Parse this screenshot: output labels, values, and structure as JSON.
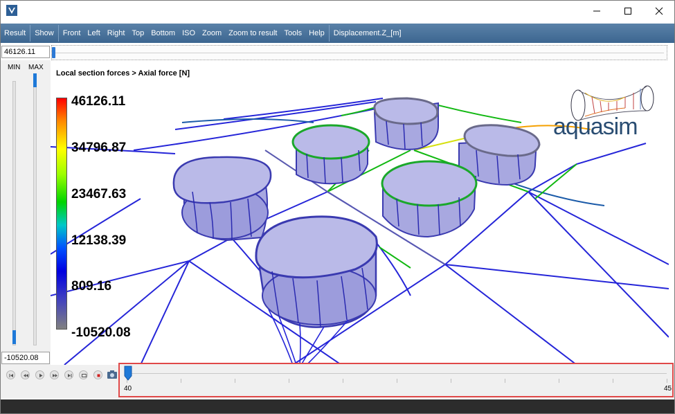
{
  "window": {
    "app_icon": "aquasim-v-icon",
    "controls": {
      "minimize": "minimize-icon",
      "maximize": "maximize-icon",
      "close": "close-icon"
    }
  },
  "toolbar": {
    "items": [
      "Result",
      "Show",
      "Front",
      "Left",
      "Right",
      "Top",
      "Bottom",
      "ISO",
      "Zoom",
      "Zoom to result",
      "Tools",
      "Help",
      "Displacement.Z_[m]"
    ]
  },
  "range": {
    "max_value": "46126.11",
    "min_value": "-10520.08",
    "min_label": "MIN",
    "max_label": "MAX"
  },
  "viewport": {
    "title": "Local section forces > Axial force [N]",
    "colorbar_labels": [
      "46126.11",
      "34796.87",
      "23467.63",
      "12138.39",
      "809.16",
      "-10520.08"
    ],
    "logo_text": "aquasim",
    "colors": {
      "low": "#0000e0",
      "mid": "#00c800",
      "high": "#ff0000",
      "net_fill": "#8e8ed6"
    }
  },
  "playback": {
    "buttons": [
      "skip-start-icon",
      "rewind-icon",
      "play-icon",
      "fast-forward-icon",
      "skip-end-icon",
      "loop-icon",
      "stop-icon",
      "camera-icon"
    ],
    "timeline_start": "40",
    "timeline_end": "45",
    "current_frame": 40
  }
}
